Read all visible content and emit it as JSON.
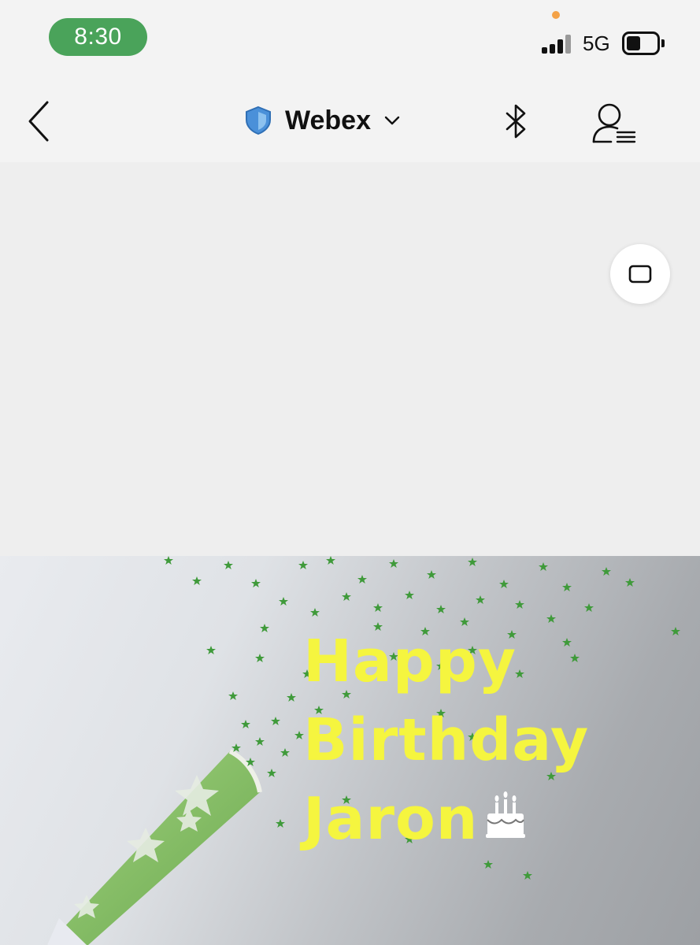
{
  "status_bar": {
    "time": "8:30",
    "network": "5G",
    "battery_level_percent": 40,
    "colors": {
      "time_pill": "#4aa35a",
      "privacy_dot": "#f4a247"
    }
  },
  "nav": {
    "title": "Webex",
    "icons": {
      "back": "chevron-left-icon",
      "title_shield": "shield-icon",
      "title_dropdown": "chevron-down-icon",
      "bluetooth": "bluetooth-icon",
      "participants": "participants-icon"
    },
    "colors": {
      "shield": "#4a90d9"
    }
  },
  "stage": {
    "layout_button_icon": "rounded-square-icon"
  },
  "banner": {
    "lines": [
      "Happy",
      "Birthday",
      "Jaron"
    ],
    "emoji_icon": "birthday-cake-icon",
    "colors": {
      "text": "#f5f53f",
      "confetti": "#4caf50",
      "horn": "#8cc56a"
    }
  }
}
